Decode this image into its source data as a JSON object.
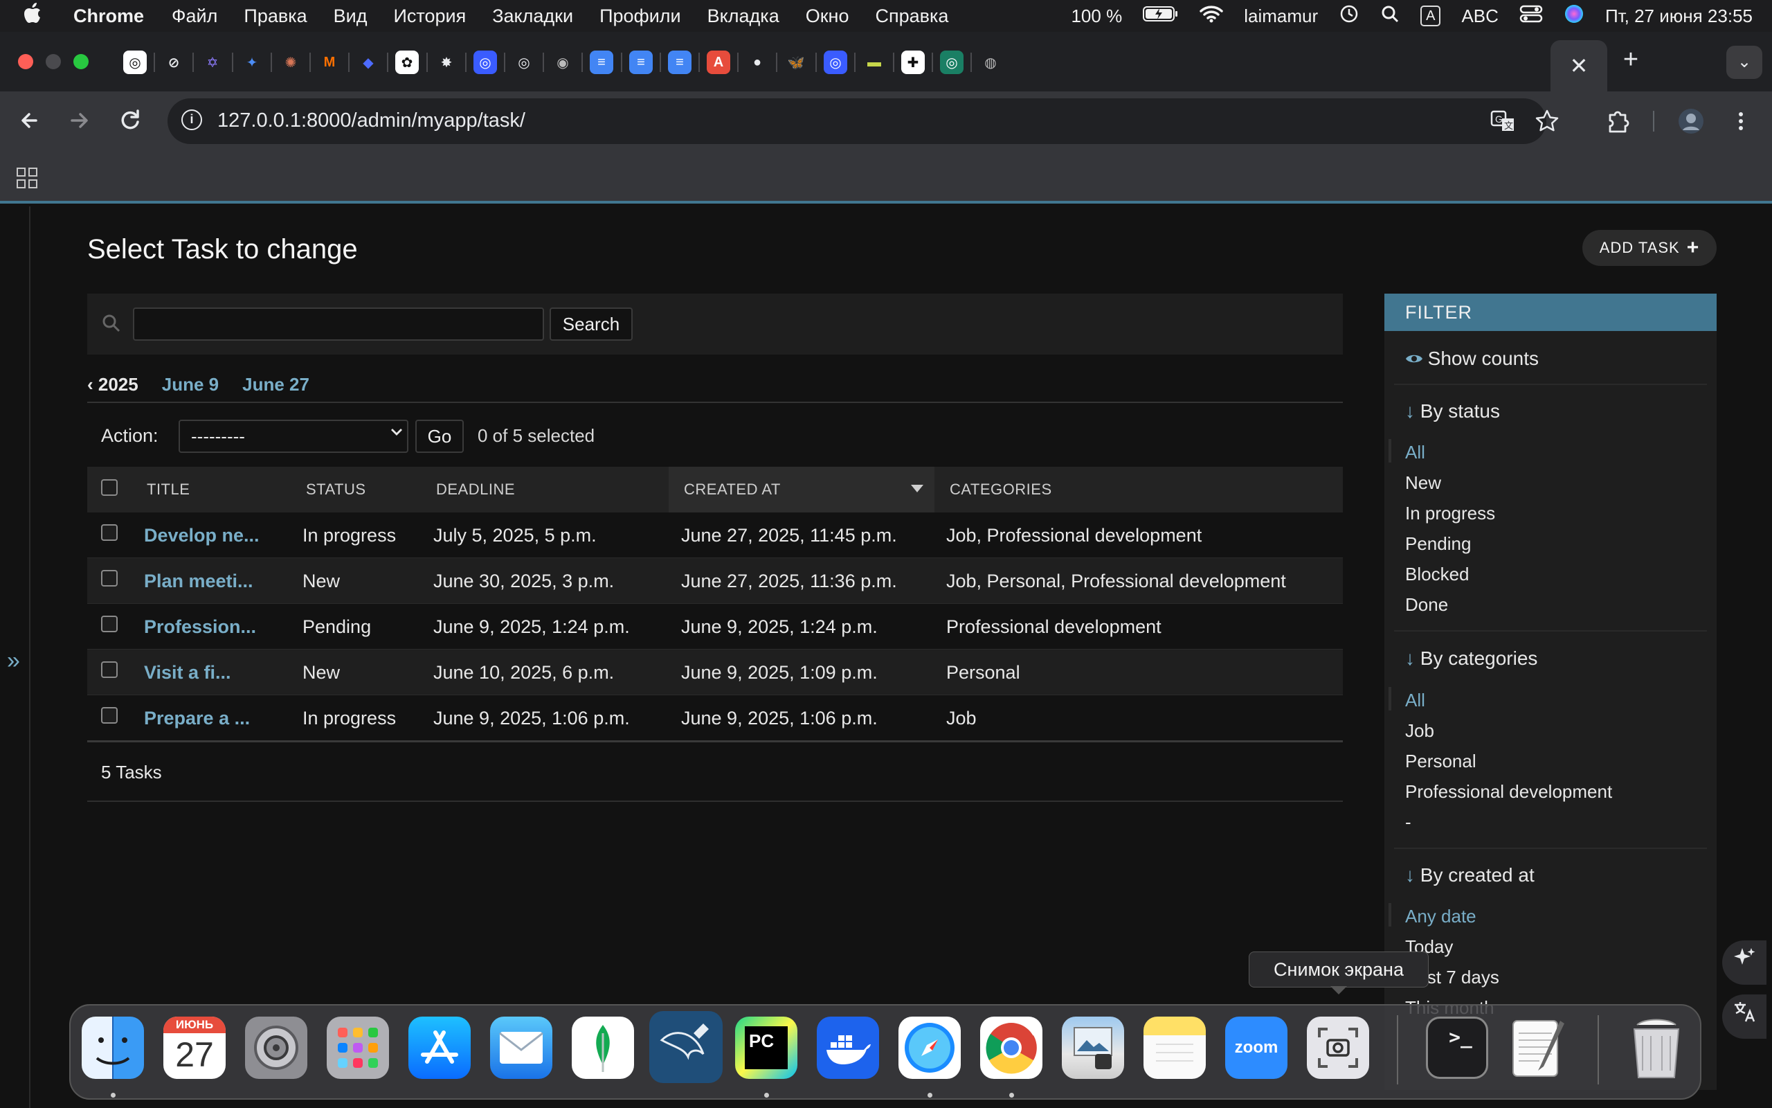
{
  "menubar": {
    "apple": "",
    "app_name": "Chrome",
    "items": [
      "Файл",
      "Правка",
      "Вид",
      "История",
      "Закладки",
      "Профили",
      "Вкладка",
      "Окно",
      "Справка"
    ],
    "battery": "100 %",
    "user": "laimamur",
    "input_indicator": "A",
    "input_source": "ABC",
    "datetime": "Пт, 27 июня  23:55"
  },
  "browser": {
    "url": "127.0.0.1:8000/admin/myapp/task/",
    "active_tab_close": "✕",
    "new_tab": "+",
    "tab_menu": "⌄",
    "tab_icons": [
      "openai",
      "perplexity",
      "gemini-alt",
      "gemini",
      "claude",
      "mistral",
      "deepseek",
      "chatgpt-dark",
      "grok",
      "chatgpt-blue",
      "openai-2",
      "copilot",
      "docs",
      "docs",
      "docs",
      "app-red",
      "github",
      "bluesky",
      "chatgpt-blue-2",
      "terminal-app",
      "app-white",
      "openai-green",
      "chrome"
    ]
  },
  "page": {
    "title": "Select Task to change",
    "add_button": "ADD TASK",
    "search": {
      "value": "",
      "button": "Search"
    },
    "date_hierarchy": {
      "back": "‹ 2025",
      "links": [
        "June 9",
        "June 27"
      ]
    },
    "action": {
      "label": "Action:",
      "selected": "---------",
      "go": "Go",
      "counter": "0 of 5 selected"
    },
    "columns": [
      "TITLE",
      "STATUS",
      "DEADLINE",
      "CREATED AT",
      "CATEGORIES"
    ],
    "rows": [
      {
        "title": "Develop ne...",
        "status": "In progress",
        "deadline": "July 5, 2025, 5 p.m.",
        "created": "June 27, 2025, 11:45 p.m.",
        "categories": "Job, Professional development"
      },
      {
        "title": "Plan meeti...",
        "status": "New",
        "deadline": "June 30, 2025, 3 p.m.",
        "created": "June 27, 2025, 11:36 p.m.",
        "categories": "Job, Personal, Professional development"
      },
      {
        "title": "Profession...",
        "status": "Pending",
        "deadline": "June 9, 2025, 1:24 p.m.",
        "created": "June 9, 2025, 1:24 p.m.",
        "categories": "Professional development"
      },
      {
        "title": "Visit a fi...",
        "status": "New",
        "deadline": "June 10, 2025, 6 p.m.",
        "created": "June 9, 2025, 1:09 p.m.",
        "categories": "Personal"
      },
      {
        "title": "Prepare a ...",
        "status": "In progress",
        "deadline": "June 9, 2025, 1:06 p.m.",
        "created": "June 9, 2025, 1:06 p.m.",
        "categories": "Job"
      }
    ],
    "paginator": "5 Tasks",
    "toggle_nav": "»"
  },
  "filter": {
    "title": "FILTER",
    "show_counts": "Show counts",
    "by_status": {
      "title": "By status",
      "items": [
        "All",
        "New",
        "In progress",
        "Pending",
        "Blocked",
        "Done"
      ]
    },
    "by_categories": {
      "title": "By categories",
      "items": [
        "All",
        "Job",
        "Personal",
        "Professional development",
        "-"
      ]
    },
    "by_created_at": {
      "title": "By created at",
      "items": [
        "Any date",
        "Today",
        "Past 7 days",
        "This month"
      ]
    }
  },
  "tooltip": "Снимок экрана",
  "dock": {
    "calendar_month": "ИЮНЬ",
    "calendar_day": "27",
    "pycharm": "PC",
    "zoom": "zoom",
    "terminal": ">_"
  },
  "colors": {
    "accent": "#79aec8",
    "header": "#417690",
    "background": "#121212"
  }
}
